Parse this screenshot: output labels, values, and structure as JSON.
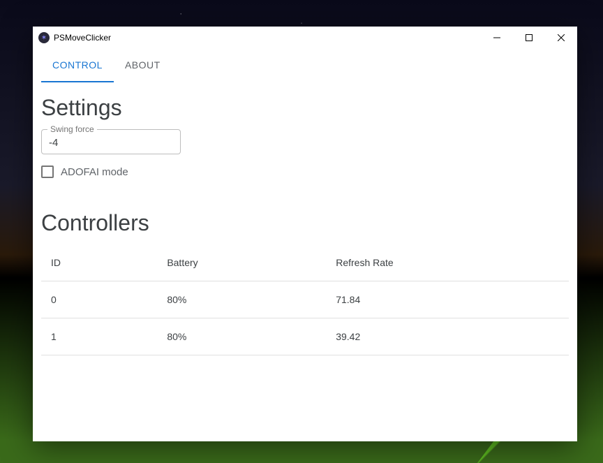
{
  "window": {
    "title": "PSMoveClicker"
  },
  "tabs": [
    {
      "label": "CONTROL",
      "active": true
    },
    {
      "label": "ABOUT",
      "active": false
    }
  ],
  "settings": {
    "heading": "Settings",
    "swing_force": {
      "label": "Swing force",
      "value": "-4"
    },
    "adofai": {
      "label": "ADOFAI mode",
      "checked": false
    }
  },
  "controllers": {
    "heading": "Controllers",
    "columns": [
      "ID",
      "Battery",
      "Refresh Rate"
    ],
    "rows": [
      {
        "id": "0",
        "battery": "80%",
        "refresh": "71.84"
      },
      {
        "id": "1",
        "battery": "80%",
        "refresh": "39.42"
      }
    ]
  }
}
